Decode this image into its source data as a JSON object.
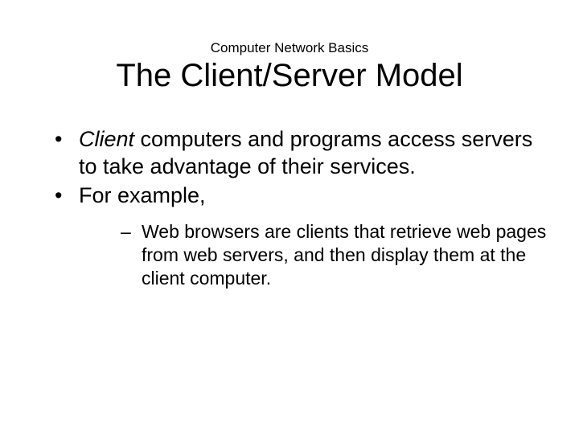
{
  "header": {
    "supertitle": "Computer Network Basics",
    "title": "The Client/Server Model"
  },
  "bullets": {
    "b1_italic": "Client",
    "b1_rest": " computers and programs access servers to take advantage of their services.",
    "b2": "For example,",
    "sub1": "Web browsers are clients that retrieve web pages from web servers, and then display them at the client computer."
  }
}
